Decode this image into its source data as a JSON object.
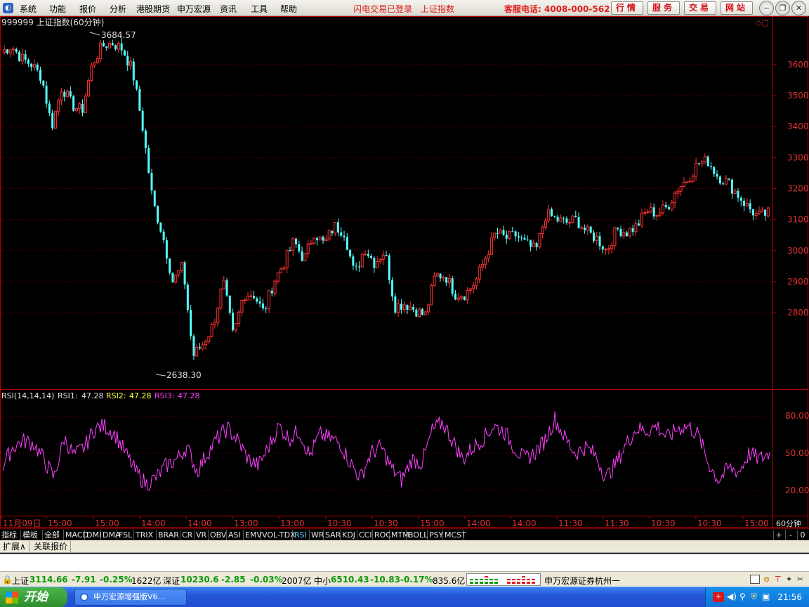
{
  "menu": {
    "items": [
      "系统",
      "功能",
      "报价",
      "分析",
      "港股期货",
      "申万宏源",
      "资讯",
      "工具",
      "帮助"
    ],
    "login_status": "闪电交易已登录",
    "index_name": "上证指数",
    "hotline": "客服电话: 4008-000-562",
    "nav_buttons": [
      "行情",
      "服务",
      "交易",
      "网站"
    ]
  },
  "chart": {
    "title": "999999 上证指数(60分钟)",
    "high_label": "3684.57",
    "low_label": "2638.30",
    "price_ticks": [
      "3600",
      "3500",
      "3400",
      "3300",
      "3200",
      "3100",
      "3000",
      "2900",
      "2800"
    ],
    "rsi_header": {
      "name": "RSI(14,14,14)",
      "rsi1_label": "RSI1:",
      "rsi1_value": "47.28",
      "rsi2_label": "RSI2:",
      "rsi2_value": "47.28",
      "rsi3_label": "RSI3:",
      "rsi3_value": "47.28"
    },
    "rsi_ticks": [
      "80.00",
      "50.00",
      "20.00"
    ],
    "time_labels": [
      "11月09日",
      "15:00",
      "15:00",
      "14:00",
      "14:00",
      "13:00",
      "13:00",
      "10:30",
      "10:30",
      "15:00",
      "14:00",
      "14:00",
      "11:30",
      "11:30",
      "10:30",
      "10:30",
      "15:00"
    ],
    "period_label": "60分钟",
    "colors": {
      "up": "#ff3232",
      "down": "#54ffff",
      "rsi": "#ff40ff",
      "axis": "#b00000",
      "grid": "#800000"
    }
  },
  "chart_data": {
    "type": "candlestick",
    "title": "999999 上证指数(60分钟)",
    "series": [
      {
        "name": "close",
        "values": [
          3640,
          3660,
          3620,
          3600,
          3560,
          3400,
          3530,
          3470,
          3450,
          3600,
          3660,
          3670,
          3650,
          3580,
          3400,
          3160,
          3050,
          2900,
          2950,
          2660,
          2700,
          2760,
          2900,
          2720,
          2860,
          2860,
          2800,
          2900,
          2960,
          3030,
          2970,
          3060,
          3020,
          3080,
          3060,
          2920,
          3010,
          2960,
          3000,
          2820,
          2830,
          2810,
          2790,
          2920,
          2920,
          2860,
          2860,
          2900,
          2980,
          3060,
          3040,
          3050,
          3020,
          3000,
          3120,
          3100,
          3090,
          3100,
          3060,
          3040,
          3000,
          3070,
          3060,
          3080,
          3130,
          3120,
          3140,
          3200,
          3230,
          3280,
          3290,
          3240,
          3220,
          3180,
          3140,
          3110,
          3120
        ]
      },
      {
        "name": "RSI1",
        "values": [
          40,
          55,
          60,
          58,
          45,
          30,
          62,
          48,
          55,
          70,
          72,
          65,
          50,
          35,
          25,
          30,
          40,
          45,
          55,
          35,
          50,
          62,
          70,
          60,
          45,
          40,
          55,
          72,
          62,
          68,
          48,
          65,
          62,
          58,
          42,
          30,
          50,
          55,
          38,
          28,
          45,
          42,
          68,
          75,
          60,
          45,
          55,
          62,
          72,
          68,
          55,
          45,
          50,
          60,
          78,
          62,
          50,
          55,
          48,
          30,
          42,
          58,
          70,
          68,
          72,
          62,
          70,
          72,
          65,
          42,
          28,
          38,
          35,
          50,
          45,
          50
        ]
      },
      {
        "name": "RSI2",
        "values": []
      },
      {
        "name": "RSI3",
        "values": []
      }
    ],
    "high": 3684.57,
    "low": 2638.3,
    "ylim": [
      2560,
      3720
    ],
    "rsi_ylim": [
      0,
      100
    ],
    "legend_position": "top-left",
    "grid": true
  },
  "indicator_tabs": [
    "指标",
    "模板",
    "全部",
    "MACD",
    "DMI",
    "DMA",
    "FSL",
    "TRIX",
    "BRAR",
    "CR",
    "VR",
    "OBV",
    "ASI",
    "EMV",
    "VOL-TDX",
    "RSI",
    "WR",
    "SAR",
    "KDJ",
    "CCI",
    "ROC",
    "MTM",
    "BOLL",
    "PSY",
    "MCST"
  ],
  "active_tab": "RSI",
  "indicator_controls": [
    "+",
    "-",
    "0"
  ],
  "ext_tabs": [
    "扩展∧",
    "关联报价"
  ],
  "status": {
    "sh_label": "上证",
    "sh_value": "3114.66",
    "sh_change": "-7.91",
    "sh_pct": "-0.25%",
    "sh_amount": "1622亿",
    "sz_label": "深证",
    "sz_value": "10230.6",
    "sz_change": "-2.85",
    "sz_pct": "-0.03%",
    "sz_amount": "2007亿",
    "zx_label": "中小",
    "zx_value": "6510.43",
    "zx_change": "-10.83",
    "zx_pct": "-0.17%",
    "zx_amount": "835.6亿",
    "broker": "申万宏源证券杭州一"
  },
  "taskbar": {
    "start": "开始",
    "task_title": "申万宏源增强版V6...",
    "clock": "21:56"
  }
}
